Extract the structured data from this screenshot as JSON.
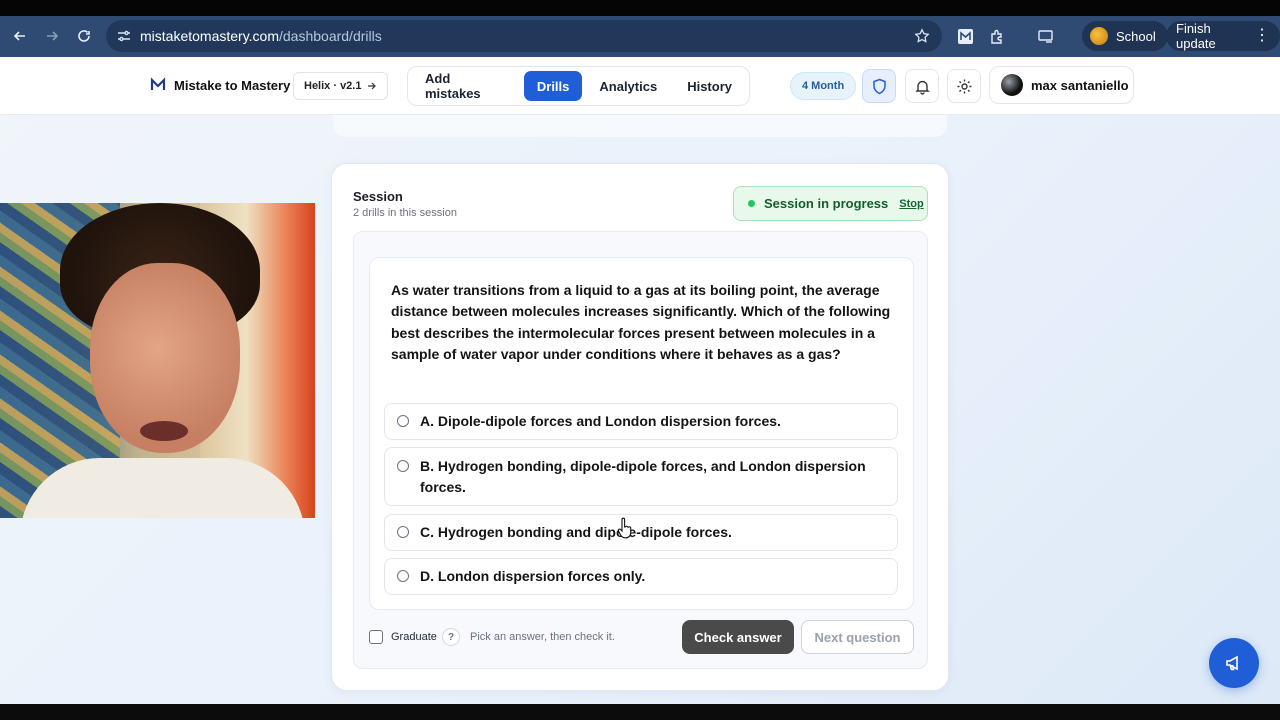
{
  "browser": {
    "url_domain": "mistaketomastery.com",
    "url_path": "/dashboard/drills",
    "profile_label": "School",
    "update_label": "Finish update"
  },
  "header": {
    "brand": "Mistake to Mastery",
    "version": "Helix · v2.1",
    "tabs": [
      {
        "label": "Add mistakes",
        "active": false
      },
      {
        "label": "Drills",
        "active": true
      },
      {
        "label": "Analytics",
        "active": false
      },
      {
        "label": "History",
        "active": false
      }
    ],
    "plan": "4 Month",
    "user": "max santaniello"
  },
  "session": {
    "title": "Session",
    "subtitle": "2 drills in this session",
    "status": "Session in progress",
    "stop_label": "Stop"
  },
  "drill": {
    "question": "As water transitions from a liquid to a gas at its boiling point, the average distance between molecules increases significantly. Which of the following best describes the intermolecular forces present between molecules in a sample of water vapor under conditions where it behaves as a gas?",
    "options": [
      "A. Dipole-dipole forces and London dispersion forces.",
      "B. Hydrogen bonding, dipole-dipole forces, and London dispersion forces.",
      "C. Hydrogen bonding and dipole-dipole forces.",
      "D. London dispersion forces only."
    ]
  },
  "footer": {
    "graduate_label": "Graduate",
    "help_label": "?",
    "hint": "Pick an answer, then check it.",
    "check_label": "Check answer",
    "next_label": "Next question"
  },
  "colors": {
    "accent": "#1f5ed6",
    "success": "#22c55e",
    "chrome": "#2f4b73"
  }
}
